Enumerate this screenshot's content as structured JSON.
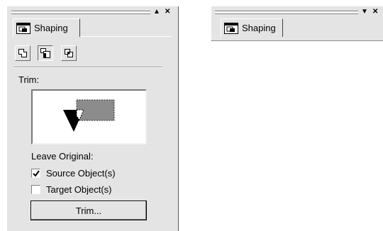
{
  "docker_expanded": {
    "collapse_glyph": "▲",
    "close_glyph": "✕",
    "tab_label": "Shaping",
    "tab_icon": "shaping-docker-icon",
    "tools": [
      {
        "name": "weld-icon",
        "state": "raised"
      },
      {
        "name": "trim-icon",
        "state": "pressed"
      },
      {
        "name": "intersect-icon",
        "state": "raised"
      }
    ],
    "section_label": "Trim:",
    "leave_original_label": "Leave Original:",
    "source_checkbox": {
      "label": "Source Object(s)",
      "checked": true
    },
    "target_checkbox": {
      "label": "Target Object(s)",
      "checked": false
    },
    "apply_button_label": "Trim..."
  },
  "docker_collapsed": {
    "expand_glyph": "▼",
    "close_glyph": "✕",
    "tab_label": "Shaping",
    "tab_icon": "shaping-docker-icon"
  },
  "colors": {
    "panel": "#e4e4e4",
    "preview_target": "#8c8c8c",
    "preview_source": "#000000"
  }
}
